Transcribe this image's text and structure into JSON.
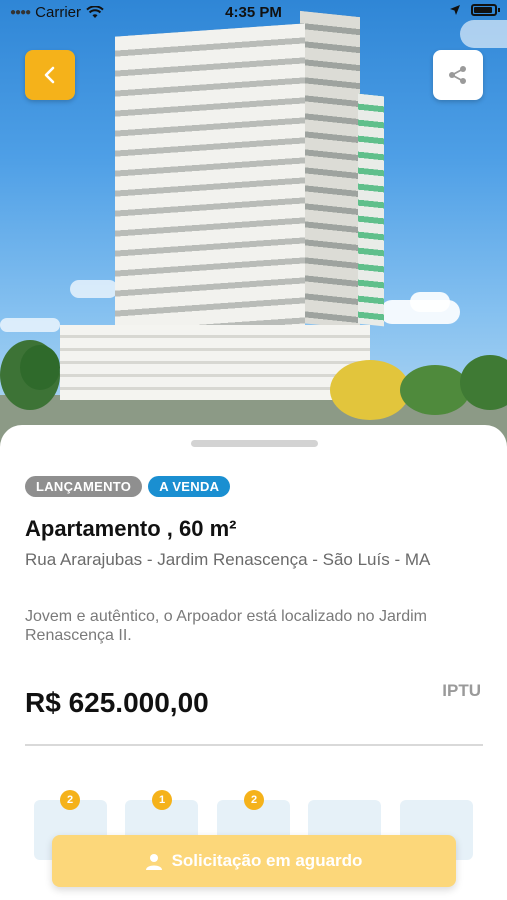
{
  "status_bar": {
    "carrier": "Carrier",
    "time": "4:35 PM"
  },
  "hero": {
    "image_description_icon": "building-photo"
  },
  "buttons": {
    "back_icon": "chevron-left-icon",
    "share_icon": "share-icon"
  },
  "listing": {
    "tags": [
      "LANÇAMENTO",
      "A VENDA"
    ],
    "title": "Apartamento , 60 m²",
    "address": "Rua Ararajubas - Jardim Renascença - São Luís - MA",
    "description": "Jovem e autêntico, o Arpoador está localizado no Jardim Renascença II.",
    "price": "R$ 625.000,00",
    "iptu_label": "IPTU"
  },
  "features": [
    {
      "count": "2"
    },
    {
      "count": "1"
    },
    {
      "count": "2"
    },
    {
      "count": ""
    },
    {
      "count": ""
    }
  ],
  "cta": {
    "label": "Solicitação em aguardo"
  },
  "colors": {
    "accent": "#f5b21a",
    "tag_blue": "#1a8fd1",
    "tag_gray": "#8f8f8f",
    "cta_disabled": "#fcd77a"
  }
}
